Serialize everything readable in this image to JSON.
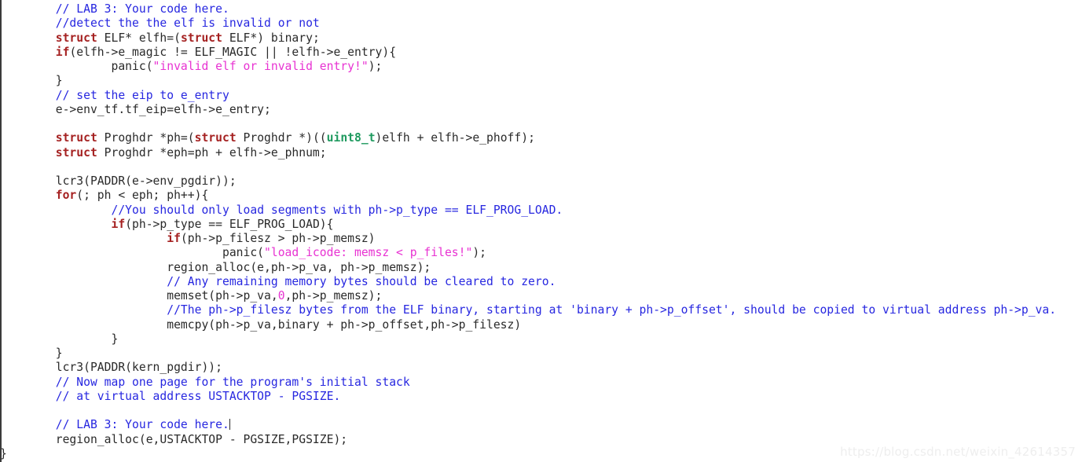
{
  "editor": {
    "language": "c",
    "background_color": "#ffffff",
    "default_text_color": "#2a2a2a",
    "colors": {
      "comment": "#2727e0",
      "keyword": "#a52121",
      "type": "#1f9a5f",
      "string": "#e832d2",
      "number": "#e832d2",
      "plain": "#2a2a2a",
      "gutter_rule": "#3b3b3b",
      "watermark": "#eeeeee"
    },
    "caret": {
      "visible": true,
      "line_index": 28,
      "after_text": "// LAB 3: Your code here."
    }
  },
  "watermark": {
    "text": "https://blog.csdn.net/weixin_42614357"
  },
  "code": {
    "lines": [
      {
        "indent": 8,
        "tokens": [
          {
            "t": "comment",
            "v": "// LAB 3: Your code here."
          }
        ]
      },
      {
        "indent": 8,
        "tokens": [
          {
            "t": "comment",
            "v": "//detect the the elf is invalid or not"
          }
        ]
      },
      {
        "indent": 8,
        "tokens": [
          {
            "t": "keyword",
            "v": "struct"
          },
          {
            "t": "plain",
            "v": " ELF* elfh=("
          },
          {
            "t": "keyword",
            "v": "struct"
          },
          {
            "t": "plain",
            "v": " ELF*) binary;"
          }
        ]
      },
      {
        "indent": 8,
        "tokens": [
          {
            "t": "keyword",
            "v": "if"
          },
          {
            "t": "plain",
            "v": "(elfh->e_magic != ELF_MAGIC || !elfh->e_entry){"
          }
        ]
      },
      {
        "indent": 8,
        "tokens": [
          {
            "t": "plain",
            "v": "        panic("
          },
          {
            "t": "string",
            "v": "\"invalid elf or invalid entry!\""
          },
          {
            "t": "plain",
            "v": ");"
          }
        ]
      },
      {
        "indent": 8,
        "tokens": [
          {
            "t": "plain",
            "v": "}"
          }
        ]
      },
      {
        "indent": 8,
        "tokens": [
          {
            "t": "comment",
            "v": "// set the eip to e_entry"
          }
        ]
      },
      {
        "indent": 8,
        "tokens": [
          {
            "t": "plain",
            "v": "e->env_tf.tf_eip=elfh->e_entry;"
          }
        ]
      },
      {
        "indent": 0,
        "tokens": []
      },
      {
        "indent": 8,
        "tokens": [
          {
            "t": "keyword",
            "v": "struct"
          },
          {
            "t": "plain",
            "v": " Proghdr *ph=("
          },
          {
            "t": "keyword",
            "v": "struct"
          },
          {
            "t": "plain",
            "v": " Proghdr *)(("
          },
          {
            "t": "type",
            "v": "uint8_t"
          },
          {
            "t": "plain",
            "v": ")elfh + elfh->e_phoff);"
          }
        ]
      },
      {
        "indent": 8,
        "tokens": [
          {
            "t": "keyword",
            "v": "struct"
          },
          {
            "t": "plain",
            "v": " Proghdr *eph=ph + elfh->e_phnum;"
          }
        ]
      },
      {
        "indent": 0,
        "tokens": []
      },
      {
        "indent": 8,
        "tokens": [
          {
            "t": "plain",
            "v": "lcr3(PADDR(e->env_pgdir));"
          }
        ]
      },
      {
        "indent": 8,
        "tokens": [
          {
            "t": "keyword",
            "v": "for"
          },
          {
            "t": "plain",
            "v": "(; ph < eph; ph++){"
          }
        ]
      },
      {
        "indent": 8,
        "tokens": [
          {
            "t": "plain",
            "v": "        "
          },
          {
            "t": "comment",
            "v": "//You should only load segments with ph->p_type == ELF_PROG_LOAD."
          }
        ]
      },
      {
        "indent": 8,
        "tokens": [
          {
            "t": "plain",
            "v": "        "
          },
          {
            "t": "keyword",
            "v": "if"
          },
          {
            "t": "plain",
            "v": "(ph->p_type == ELF_PROG_LOAD){"
          }
        ]
      },
      {
        "indent": 8,
        "tokens": [
          {
            "t": "plain",
            "v": "                "
          },
          {
            "t": "keyword",
            "v": "if"
          },
          {
            "t": "plain",
            "v": "(ph->p_filesz > ph->p_memsz)"
          }
        ]
      },
      {
        "indent": 8,
        "tokens": [
          {
            "t": "plain",
            "v": "                        panic("
          },
          {
            "t": "string",
            "v": "\"load_icode: memsz < p_files!\""
          },
          {
            "t": "plain",
            "v": ");"
          }
        ]
      },
      {
        "indent": 8,
        "tokens": [
          {
            "t": "plain",
            "v": "                region_alloc(e,ph->p_va, ph->p_memsz);"
          }
        ]
      },
      {
        "indent": 8,
        "tokens": [
          {
            "t": "plain",
            "v": "                "
          },
          {
            "t": "comment",
            "v": "// Any remaining memory bytes should be cleared to zero."
          }
        ]
      },
      {
        "indent": 8,
        "tokens": [
          {
            "t": "plain",
            "v": "                memset(ph->p_va,"
          },
          {
            "t": "number",
            "v": "0"
          },
          {
            "t": "plain",
            "v": ",ph->p_memsz);"
          }
        ]
      },
      {
        "indent": 8,
        "tokens": [
          {
            "t": "plain",
            "v": "                "
          },
          {
            "t": "comment",
            "v": "//The ph->p_filesz bytes from the ELF binary, starting at 'binary + ph->p_offset', should be copied to virtual address ph->p_va."
          }
        ]
      },
      {
        "indent": 8,
        "tokens": [
          {
            "t": "plain",
            "v": "                memcpy(ph->p_va,binary + ph->p_offset,ph->p_filesz)"
          }
        ]
      },
      {
        "indent": 8,
        "tokens": [
          {
            "t": "plain",
            "v": "        }"
          }
        ]
      },
      {
        "indent": 8,
        "tokens": [
          {
            "t": "plain",
            "v": "}"
          }
        ]
      },
      {
        "indent": 8,
        "tokens": [
          {
            "t": "plain",
            "v": "lcr3(PADDR(kern_pgdir));"
          }
        ]
      },
      {
        "indent": 8,
        "tokens": [
          {
            "t": "comment",
            "v": "// Now map one page for the program's initial stack"
          }
        ]
      },
      {
        "indent": 8,
        "tokens": [
          {
            "t": "comment",
            "v": "// at virtual address USTACKTOP - PGSIZE."
          }
        ]
      },
      {
        "indent": 0,
        "tokens": []
      },
      {
        "indent": 8,
        "tokens": [
          {
            "t": "comment",
            "v": "// LAB 3: Your code here."
          },
          {
            "t": "caret",
            "v": ""
          }
        ]
      },
      {
        "indent": 8,
        "tokens": [
          {
            "t": "plain",
            "v": "region_alloc(e,USTACKTOP - PGSIZE,PGSIZE);"
          }
        ]
      },
      {
        "indent": 0,
        "tokens": [
          {
            "t": "plain",
            "v": "}"
          }
        ]
      }
    ]
  }
}
